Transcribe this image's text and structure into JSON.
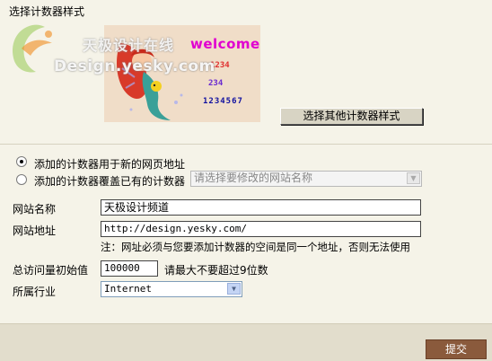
{
  "section_title": "选择计数器样式",
  "watermark": {
    "line1": "天极设计在线",
    "line2": "Design.yesky.com"
  },
  "preview": {
    "welcome": "welcome",
    "numbers": [
      "1234",
      "234",
      "1234567"
    ]
  },
  "choose_style_button": "选择其他计数器样式",
  "counter_mode": {
    "options": [
      {
        "label": "添加的计数器用于新的网页地址",
        "checked": true
      },
      {
        "label": "添加的计数器覆盖已有的计数器",
        "checked": false
      }
    ],
    "site_select_placeholder": "请选择要修改的网站名称"
  },
  "form": {
    "site_name_label": "网站名称",
    "site_name_value": "天极设计频道",
    "site_url_label": "网站地址",
    "site_url_value": "http://design.yesky.com/",
    "url_note": "注：网址必须与您要添加计数器的空间是同一个地址，否则无法使用",
    "initial_count_label": "总访问量初始值",
    "initial_count_value": "100000",
    "initial_count_hint": "请最大不要超过9位数",
    "industry_label": "所属行业",
    "industry_value": "Internet"
  },
  "submit_button": "提交"
}
